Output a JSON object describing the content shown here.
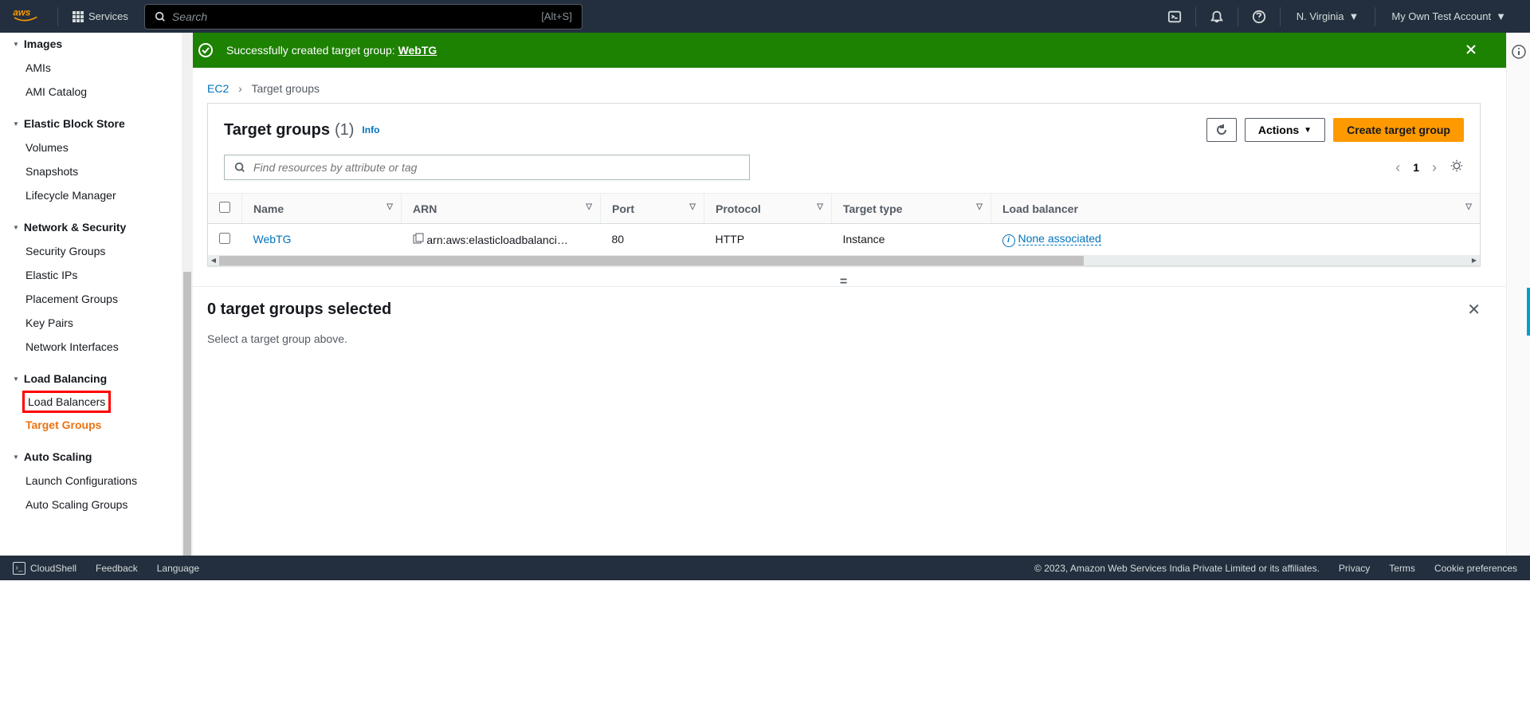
{
  "header": {
    "services": "Services",
    "search_placeholder": "Search",
    "shortcut": "[Alt+S]",
    "region": "N. Virginia",
    "account": "My Own Test Account"
  },
  "sidebar": {
    "images_head": "Images",
    "images": {
      "amis": "AMIs",
      "catalog": "AMI Catalog"
    },
    "ebs_head": "Elastic Block Store",
    "ebs": {
      "volumes": "Volumes",
      "snapshots": "Snapshots",
      "lifecycle": "Lifecycle Manager"
    },
    "netsec_head": "Network & Security",
    "netsec": {
      "sg": "Security Groups",
      "eip": "Elastic IPs",
      "pg": "Placement Groups",
      "kp": "Key Pairs",
      "ni": "Network Interfaces"
    },
    "lb_head": "Load Balancing",
    "lb": {
      "load_balancers": "Load Balancers",
      "target_groups": "Target Groups"
    },
    "as_head": "Auto Scaling",
    "as": {
      "launch_configurations": "Launch Configurations",
      "asg": "Auto Scaling Groups"
    }
  },
  "alert": {
    "prefix": "Successfully created target group: ",
    "link": "WebTG"
  },
  "breadcrumb": {
    "root": "EC2",
    "current": "Target groups"
  },
  "panel": {
    "title": "Target groups",
    "count": "(1)",
    "info": "Info",
    "actions": "Actions",
    "create": "Create target group",
    "filter_placeholder": "Find resources by attribute or tag",
    "page": "1"
  },
  "table": {
    "cols": {
      "name": "Name",
      "arn": "ARN",
      "port": "Port",
      "protocol": "Protocol",
      "target_type": "Target type",
      "load_balancer": "Load balancer"
    },
    "row": {
      "name": "WebTG",
      "arn": "arn:aws:elasticloadbalanci…",
      "port": "80",
      "protocol": "HTTP",
      "target_type": "Instance",
      "lb": "None associated"
    }
  },
  "detail": {
    "title": "0 target groups selected",
    "body": "Select a target group above."
  },
  "footer": {
    "cloudshell": "CloudShell",
    "feedback": "Feedback",
    "language": "Language",
    "copyright": "© 2023, Amazon Web Services India Private Limited or its affiliates.",
    "privacy": "Privacy",
    "terms": "Terms",
    "cookies": "Cookie preferences"
  }
}
